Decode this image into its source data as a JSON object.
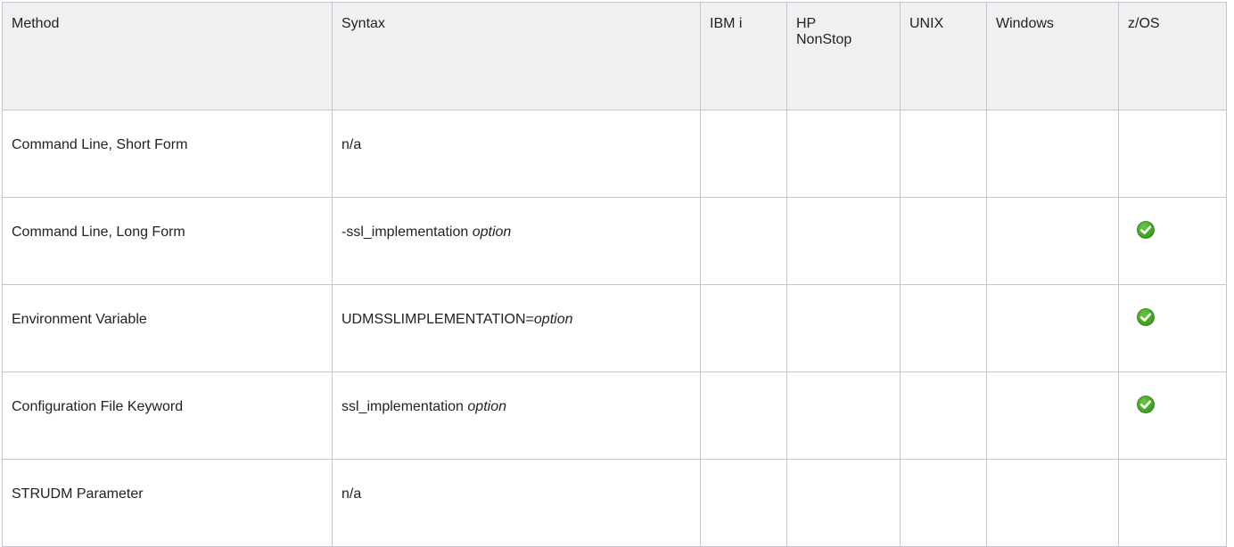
{
  "table": {
    "headers": [
      "Method",
      "Syntax",
      "IBM i",
      "HP NonStop",
      "UNIX",
      "Windows",
      "z/OS"
    ],
    "rows": [
      {
        "method": "Command Line, Short Form",
        "syntax_plain": "n/a",
        "syntax_italic": "",
        "zos_supported": false
      },
      {
        "method": "Command Line, Long Form",
        "syntax_plain": "-ssl_implementation ",
        "syntax_italic": "option",
        "zos_supported": true
      },
      {
        "method": "Environment Variable",
        "syntax_plain": "UDMSSLIMPLEMENTATION=",
        "syntax_italic": "option",
        "zos_supported": true
      },
      {
        "method": "Configuration File Keyword",
        "syntax_plain": "ssl_implementation ",
        "syntax_italic": "option",
        "zos_supported": true
      },
      {
        "method": "STRUDM Parameter",
        "syntax_plain": "n/a",
        "syntax_italic": "",
        "zos_supported": false
      }
    ]
  },
  "icons": {
    "check": "check-circle-icon",
    "check_color": "#3a9a1e",
    "check_color_light": "#6cc644"
  },
  "colors": {
    "header_bg": "#f0f0f0",
    "border": "#c1c7d0",
    "text": "#222222"
  }
}
